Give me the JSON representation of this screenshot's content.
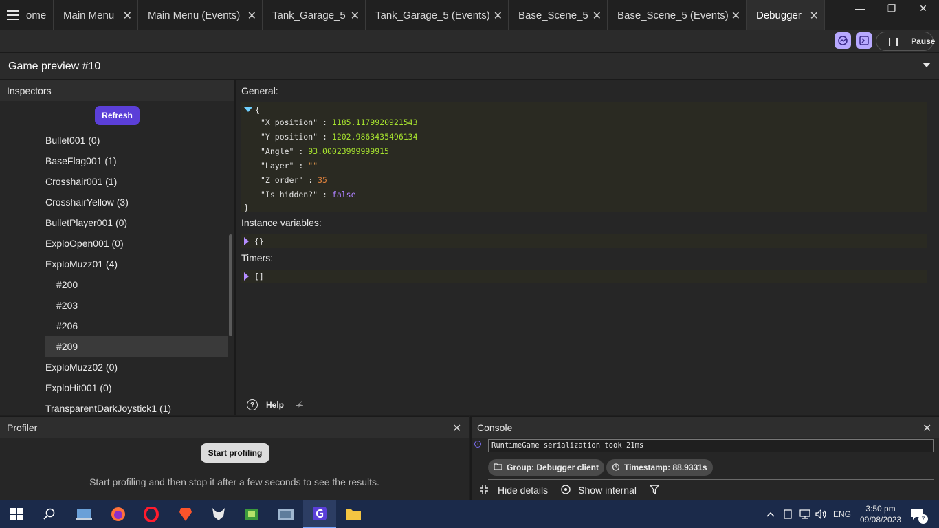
{
  "tabs": [
    {
      "label": "ome",
      "closable": false
    },
    {
      "label": "Main Menu",
      "closable": true
    },
    {
      "label": "Main Menu (Events)",
      "closable": true
    },
    {
      "label": "Tank_Garage_5",
      "closable": true
    },
    {
      "label": "Tank_Garage_5 (Events)",
      "closable": true
    },
    {
      "label": "Base_Scene_5",
      "closable": true
    },
    {
      "label": "Base_Scene_5 (Events)",
      "closable": true
    },
    {
      "label": "Debugger",
      "closable": true,
      "active": true
    }
  ],
  "tab_close_glyph": "✕",
  "window_controls": {
    "minimize": "—",
    "restore": "❐",
    "close": "✕"
  },
  "toolbar": {
    "pause_icon": "❙❙",
    "pause_label": "Pause"
  },
  "preview": {
    "title": "Game preview #10"
  },
  "inspectors": {
    "title": "Inspectors",
    "refresh_label": "Refresh",
    "items": [
      {
        "label": "Bullet001 (0)"
      },
      {
        "label": "BaseFlag001 (1)"
      },
      {
        "label": "Crosshair001 (1)"
      },
      {
        "label": "CrosshairYellow (3)"
      },
      {
        "label": "BulletPlayer001 (0)"
      },
      {
        "label": "ExploOpen001 (0)"
      },
      {
        "label": "ExploMuzz01 (4)"
      },
      {
        "label": "#200",
        "child": true
      },
      {
        "label": "#203",
        "child": true
      },
      {
        "label": "#206",
        "child": true
      },
      {
        "label": "#209",
        "child": true,
        "selected": true
      },
      {
        "label": "ExploMuzz02 (0)"
      },
      {
        "label": "ExploHit001 (0)"
      },
      {
        "label": "TransparentDarkJoystick1 (1)"
      }
    ]
  },
  "general": {
    "title": "General:",
    "open_brace": "{",
    "close_brace": "}",
    "fields": [
      {
        "key": "\"X position\"",
        "value": "1185.1179920921543",
        "type": "num"
      },
      {
        "key": "\"Y position\"",
        "value": "1202.9863435496134",
        "type": "num"
      },
      {
        "key": "\"Angle\"",
        "value": "93.00023999999915",
        "type": "num"
      },
      {
        "key": "\"Layer\"",
        "value": "\"\"",
        "type": "str"
      },
      {
        "key": "\"Z order\"",
        "value": "35",
        "type": "orange"
      },
      {
        "key": "\"Is hidden?\"",
        "value": "false",
        "type": "bool"
      }
    ],
    "separator": ":"
  },
  "instance_variables": {
    "title": "Instance variables:",
    "value": "{}"
  },
  "timers": {
    "title": "Timers:",
    "value": "[]"
  },
  "help": {
    "label": "Help",
    "help_glyph": "?",
    "flash_glyph": "⚡"
  },
  "profiler": {
    "title": "Profiler",
    "start_label": "Start profiling",
    "message": "Start profiling and then stop it after a few seconds to see the results.",
    "close_glyph": "✕"
  },
  "console": {
    "title": "Console",
    "close_glyph": "✕",
    "log_message": "RuntimeGame serialization took 21ms",
    "group_label": "Group: Debugger client",
    "timestamp_label": "Timestamp: 88.9331s",
    "hide_details_label": "Hide details",
    "show_internal_label": "Show internal"
  },
  "taskbar": {
    "lang": "ENG",
    "time": "3:50 pm",
    "date": "09/08/2023",
    "notification_count": "7"
  },
  "colors": {
    "accent": "#5b3fd8",
    "number": "#a6e22e",
    "string": "#e69a4d",
    "boolean": "#ae81ff"
  }
}
